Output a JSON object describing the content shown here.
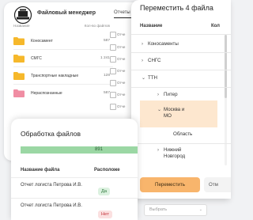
{
  "file_manager": {
    "title": "Файловый менеджер",
    "tab": "Отчеты",
    "columns": {
      "name": "Название",
      "count": "Кол-во файлов"
    },
    "folders": [
      {
        "name": "Коносамент",
        "count": "587",
        "color": "#f6b82b"
      },
      {
        "name": "СМГС",
        "count": "1 241",
        "color": "#f6b82b"
      },
      {
        "name": "Транспортные накладные",
        "count": "128",
        "color": "#f6b82b"
      },
      {
        "name": "Нераспознанные",
        "count": "587",
        "color": "#f08da3"
      }
    ],
    "right_col": [
      "Отче",
      "Отче",
      "Отче",
      "Отче",
      "Отче",
      "Отче",
      "Отче"
    ]
  },
  "move_dialog": {
    "title": "Переместить 4 файла",
    "columns": {
      "name": "Название",
      "count": "Кол"
    },
    "tree": [
      {
        "label": "Коносаменты",
        "chevron": "›"
      },
      {
        "label": "СНГС",
        "chevron": "›"
      },
      {
        "label": "ТТН",
        "chevron": "⌄"
      },
      {
        "label": "Питер",
        "chevron": "›"
      },
      {
        "label": "Москва и МО",
        "chevron": "⌄"
      },
      {
        "label": "Область",
        "chevron": ""
      },
      {
        "label": "Нижний Новгород",
        "chevron": "›"
      }
    ],
    "primary_button": "Переместить",
    "secondary_button": "Отм",
    "accent": "#f8b56c"
  },
  "processing": {
    "title": "Обработка файлов",
    "progress_label": "891",
    "progress_color": "#9bd7a4",
    "columns": {
      "name": "Название файла",
      "status": "Расположе"
    },
    "rows": [
      {
        "name": "Отчет логиста Петрова И.В.",
        "status": "Да",
        "status_kind": "yes"
      },
      {
        "name": "Отчет логиста Петрова И.В.",
        "status": "Нет",
        "status_kind": "no"
      }
    ],
    "select_placeholder": "Выбрать"
  }
}
